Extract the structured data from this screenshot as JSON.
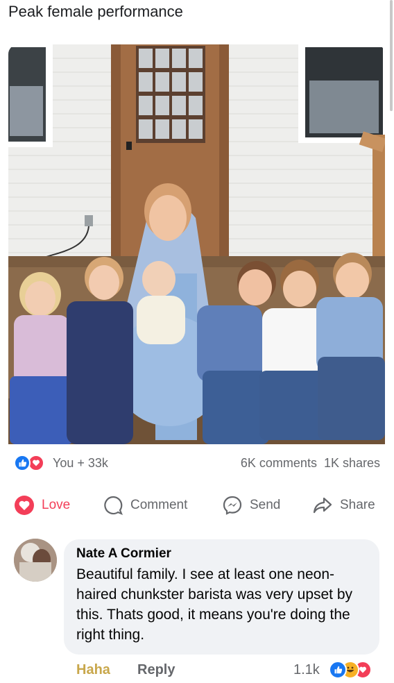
{
  "post": {
    "caption": "Peak female performance"
  },
  "stats": {
    "reaction_icons": [
      "like-icon",
      "love-icon"
    ],
    "likes": "You + 33k",
    "comments": "6K comments",
    "shares": "1K shares"
  },
  "actions": {
    "love": "Love",
    "comment": "Comment",
    "send": "Send",
    "share": "Share"
  },
  "comment": {
    "author": "Nate A Cormier",
    "text": "Beautiful family.  I see at least one neon-haired chunkster barista was very upset by this. Thats good, it means you're doing the right thing.",
    "reaction_label": "Haha",
    "reply_label": "Reply",
    "reaction_count": "1.1k",
    "reaction_icons": [
      "like-icon",
      "haha-icon",
      "love-icon"
    ]
  },
  "colors": {
    "like_blue": "#1877f2",
    "love_red": "#f33e58",
    "haha_yellow": "#f7b125",
    "haha_text": "#c8a74b",
    "muted_text": "#65676b",
    "bubble_bg": "#f0f2f5"
  }
}
